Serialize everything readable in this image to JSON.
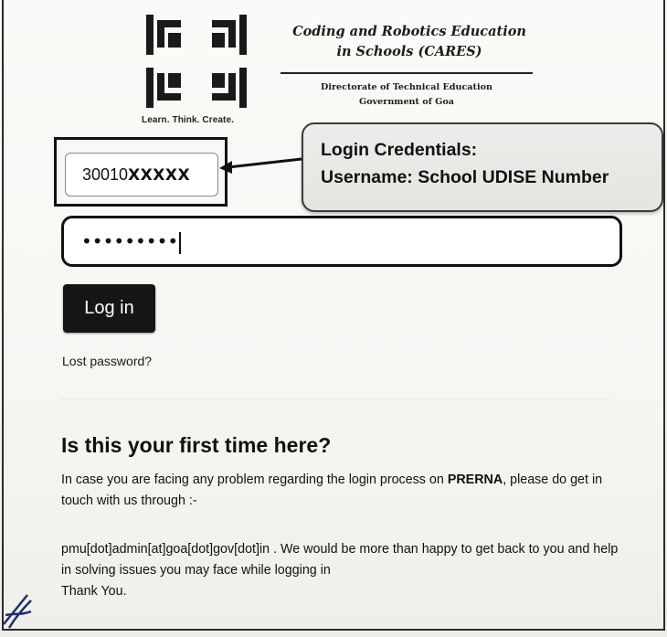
{
  "header": {
    "tagline": "Learn. Think. Create.",
    "org_title_line1": "Coding and Robotics Education",
    "org_title_line2": "in Schools (CARES)",
    "dept_line1": "Directorate of Technical Education",
    "dept_line2": "Government of Goa"
  },
  "login": {
    "username_prefix": "30010",
    "username_mask": "XXXXX",
    "password_mask": "•••••••••",
    "login_button": "Log in",
    "lost_password": "Lost password?"
  },
  "callout": {
    "title": "Login Credentials:",
    "body": "Username: School UDISE Number"
  },
  "first_time": {
    "title": "Is this your first time here?",
    "para1_text": "In case you are facing any problem regarding the login process on ",
    "para1_bold": "PRERNA",
    "para1_rest": ", please do get in touch with us through :-",
    "para2": "pmu[dot]admin[at]goa[dot]gov[dot]in . We would be more than happy to get back to you and help in solving issues you may face while logging in",
    "para3": "Thank You."
  },
  "icons": [
    "cares-logo-icon",
    "arrow-icon",
    "signature-mark"
  ],
  "colors": {
    "button_bg": "#151515",
    "button_text": "#ffffff",
    "callout_bg": "#e8e8e6",
    "page_bg": "#f8f8f6"
  }
}
